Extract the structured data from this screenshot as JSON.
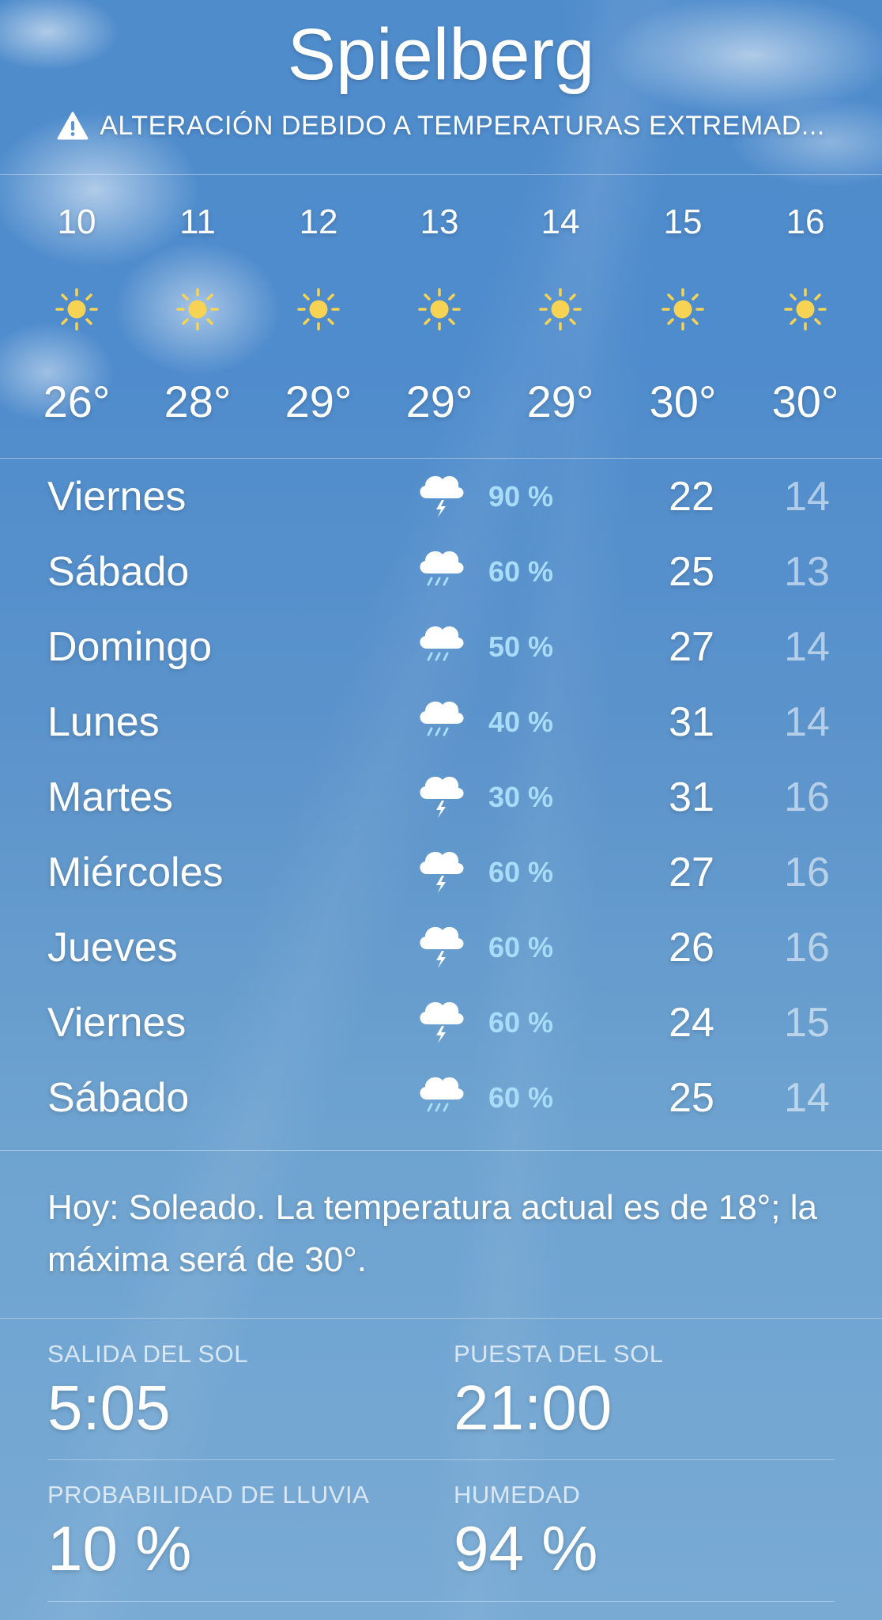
{
  "city": "Spielberg",
  "alert": {
    "icon": "warning-icon",
    "text": "ALTERACIÓN DEBIDO A TEMPERATURAS EXTREMAD..."
  },
  "hourly": [
    {
      "time": "10",
      "icon": "sun-icon",
      "temp": "26°"
    },
    {
      "time": "11",
      "icon": "sun-icon",
      "temp": "28°"
    },
    {
      "time": "12",
      "icon": "sun-icon",
      "temp": "29°"
    },
    {
      "time": "13",
      "icon": "sun-icon",
      "temp": "29°"
    },
    {
      "time": "14",
      "icon": "sun-icon",
      "temp": "29°"
    },
    {
      "time": "15",
      "icon": "sun-icon",
      "temp": "30°"
    },
    {
      "time": "16",
      "icon": "sun-icon",
      "temp": "30°"
    }
  ],
  "daily": [
    {
      "day": "Viernes",
      "icon": "thunderstorm-icon",
      "chance": "90 %",
      "high": "22",
      "low": "14"
    },
    {
      "day": "Sábado",
      "icon": "rain-icon",
      "chance": "60 %",
      "high": "25",
      "low": "13"
    },
    {
      "day": "Domingo",
      "icon": "rain-icon",
      "chance": "50 %",
      "high": "27",
      "low": "14"
    },
    {
      "day": "Lunes",
      "icon": "rain-icon",
      "chance": "40 %",
      "high": "31",
      "low": "14"
    },
    {
      "day": "Martes",
      "icon": "thunderstorm-icon",
      "chance": "30 %",
      "high": "31",
      "low": "16"
    },
    {
      "day": "Miércoles",
      "icon": "thunderstorm-icon",
      "chance": "60 %",
      "high": "27",
      "low": "16"
    },
    {
      "day": "Jueves",
      "icon": "thunderstorm-icon",
      "chance": "60 %",
      "high": "26",
      "low": "16"
    },
    {
      "day": "Viernes",
      "icon": "thunderstorm-icon",
      "chance": "60 %",
      "high": "24",
      "low": "15"
    },
    {
      "day": "Sábado",
      "icon": "rain-icon",
      "chance": "60 %",
      "high": "25",
      "low": "14"
    }
  ],
  "summary": "Hoy: Soleado. La temperatura actual es de 18°; la máxima será de 30°.",
  "details": {
    "sunrise_label": "SALIDA DEL SOL",
    "sunrise_value": "5:05",
    "sunset_label": "PUESTA DEL SOL",
    "sunset_value": "21:00",
    "rain_label": "PROBABILIDAD DE LLUVIA",
    "rain_value": "10 %",
    "humidity_label": "HUMEDAD",
    "humidity_value": "94 %"
  },
  "colors": {
    "chance": "#a8dcf8",
    "sun": "#f7d354",
    "sky_top": "#4f8ccc",
    "sky_bottom": "#78aad4"
  }
}
